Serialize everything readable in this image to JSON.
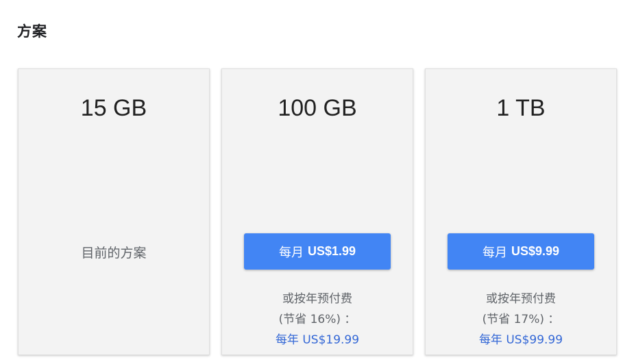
{
  "page": {
    "title": "方案"
  },
  "plans": [
    {
      "size": "15 GB",
      "current_label": "目前的方案"
    },
    {
      "size": "100 GB",
      "button_prefix": "每月",
      "button_price": "US$1.99",
      "annual_line1": "或按年预付费",
      "annual_line2": "(节省 16%) ：",
      "annual_link": "每年 US$19.99"
    },
    {
      "size": "1 TB",
      "button_prefix": "每月",
      "button_price": "US$9.99",
      "annual_line1": "或按年预付费",
      "annual_line2": "(节省 17%) ：",
      "annual_link": "每年 US$99.99"
    }
  ],
  "colors": {
    "card_bg": "#f3f3f3",
    "button_bg": "#4285f4",
    "link": "#3367d6",
    "muted_text": "#5f6368"
  }
}
